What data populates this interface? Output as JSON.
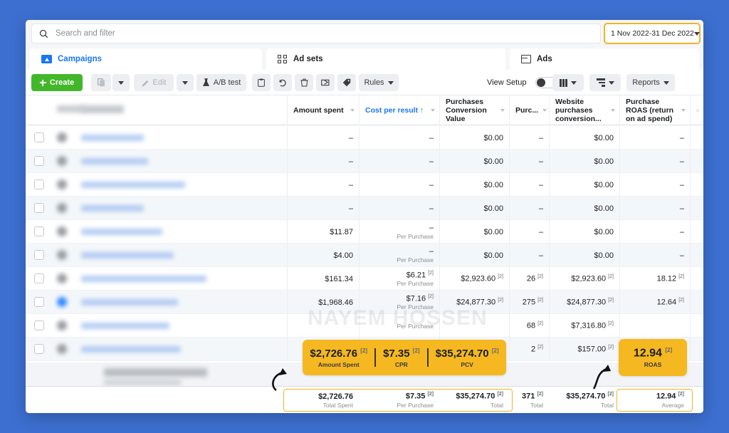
{
  "search": {
    "placeholder": "Search and filter",
    "icon": "search-icon"
  },
  "date_range": {
    "value": "1 Nov 2022-31 Dec 2022"
  },
  "tabs": [
    {
      "label": "Campaigns",
      "icon": "campaigns-icon",
      "active": true
    },
    {
      "label": "Ad sets",
      "icon": "adsets-icon",
      "active": false
    },
    {
      "label": "Ads",
      "icon": "ads-icon",
      "active": false
    }
  ],
  "toolbar": {
    "create_label": "Create",
    "edit_label": "Edit",
    "abtest_label": "A/B test",
    "rules_label": "Rules",
    "view_setup_label": "View Setup",
    "reports_label": "Reports",
    "icons": [
      "duplicate-icon",
      "edit-icon",
      "flask-icon",
      "clipboard-icon",
      "undo-icon",
      "trash-icon",
      "export-icon",
      "tag-icon",
      "columns-icon",
      "breakdown-icon"
    ]
  },
  "columns": [
    {
      "key": "amount_spent",
      "label": "Amount spent",
      "sorted": false
    },
    {
      "key": "cost_per_result",
      "label": "Cost per result ↑",
      "sorted": true
    },
    {
      "key": "purchases_conversion_value",
      "label": "Purchases Conversion Value",
      "sorted": false
    },
    {
      "key": "purchases",
      "label": "Purc...",
      "sorted": false
    },
    {
      "key": "website_purchases_conversion",
      "label": "Website purchases conversion...",
      "sorted": false
    },
    {
      "key": "purchase_roas",
      "label": "Purchase ROAS (return on ad spend)",
      "sorted": false
    }
  ],
  "rows": [
    {
      "amount_spent": "–",
      "cpr": "–",
      "cpr_sub": "",
      "pcv": "$0.00",
      "purchases": "–",
      "wpc": "$0.00",
      "roas": "–"
    },
    {
      "amount_spent": "–",
      "cpr": "–",
      "cpr_sub": "",
      "pcv": "$0.00",
      "purchases": "–",
      "wpc": "$0.00",
      "roas": "–"
    },
    {
      "amount_spent": "–",
      "cpr": "–",
      "cpr_sub": "",
      "pcv": "$0.00",
      "purchases": "–",
      "wpc": "$0.00",
      "roas": "–"
    },
    {
      "amount_spent": "–",
      "cpr": "–",
      "cpr_sub": "",
      "pcv": "$0.00",
      "purchases": "–",
      "wpc": "$0.00",
      "roas": "–"
    },
    {
      "amount_spent": "$11.87",
      "cpr": "–",
      "cpr_sub": "Per Purchase",
      "pcv": "$0.00",
      "purchases": "–",
      "wpc": "$0.00",
      "roas": "–"
    },
    {
      "amount_spent": "$4.00",
      "cpr": "–",
      "cpr_sub": "Per Purchase",
      "pcv": "$0.00",
      "purchases": "–",
      "wpc": "$0.00",
      "roas": "–"
    },
    {
      "amount_spent": "$161.34",
      "cpr": "$6.21",
      "cpr_sup": "[2]",
      "cpr_sub": "Per Purchase",
      "pcv": "$2,923.60",
      "pcv_sup": "[2]",
      "purchases": "26",
      "purchases_sup": "[2]",
      "wpc": "$2,923.60",
      "wpc_sup": "[2]",
      "roas": "18.12",
      "roas_sup": "[2]"
    },
    {
      "amount_spent": "$1,968.46",
      "cpr": "$7.16",
      "cpr_sup": "[2]",
      "cpr_sub": "Per Purchase",
      "pcv": "$24,877.30",
      "pcv_sup": "[2]",
      "purchases": "275",
      "purchases_sup": "[2]",
      "wpc": "$24,877.30",
      "wpc_sup": "[2]",
      "roas": "12.64",
      "roas_sup": "[2]"
    },
    {
      "amount_spent": "",
      "cpr": "",
      "cpr_sub": "Per Purchase",
      "pcv": "",
      "purchases": "68",
      "purchases_sup": "[2]",
      "wpc": "$7,316.80",
      "wpc_sup": "[2]",
      "roas": ""
    },
    {
      "amount_spent": "",
      "cpr": "",
      "cpr_sub": "",
      "pcv": "",
      "purchases": "2",
      "purchases_sup": "[2]",
      "wpc": "$157.00",
      "wpc_sup": "[2]",
      "roas": ""
    }
  ],
  "totals": {
    "amount_spent": {
      "value": "$2,726.76",
      "sub": "Total Spent"
    },
    "cost_per_result": {
      "value": "$7.35",
      "sup": "[2]",
      "sub": "Per Purchase"
    },
    "purchases_conversion_value": {
      "value": "$35,274.70",
      "sup": "[2]",
      "sub": "Total"
    },
    "purchases": {
      "value": "371",
      "sup": "[2]",
      "sub": "Total"
    },
    "website_purchases_conversion": {
      "value": "$35,274.70",
      "sup": "[2]",
      "sub": "Total"
    },
    "purchase_roas": {
      "value": "12.94",
      "sup": "[2]",
      "sub": "Average"
    }
  },
  "callouts": {
    "main": [
      {
        "value": "$2,726.76",
        "sup": "[2]",
        "label": "Amount Spent"
      },
      {
        "value": "$7.35",
        "sup": "[2]",
        "label": "CPR"
      },
      {
        "value": "$35,274.70",
        "sup": "[2]",
        "label": "PCV"
      }
    ],
    "roas": {
      "value": "12.94",
      "sup": "[2]",
      "label": "ROAS"
    }
  },
  "watermark": "NAYEM HOSSEN",
  "colors": {
    "background": "#3c6fd0",
    "accent_yellow": "#f5b820",
    "highlight_border": "#f0b429",
    "link_blue": "#1877f2",
    "create_green": "#42b72a"
  }
}
